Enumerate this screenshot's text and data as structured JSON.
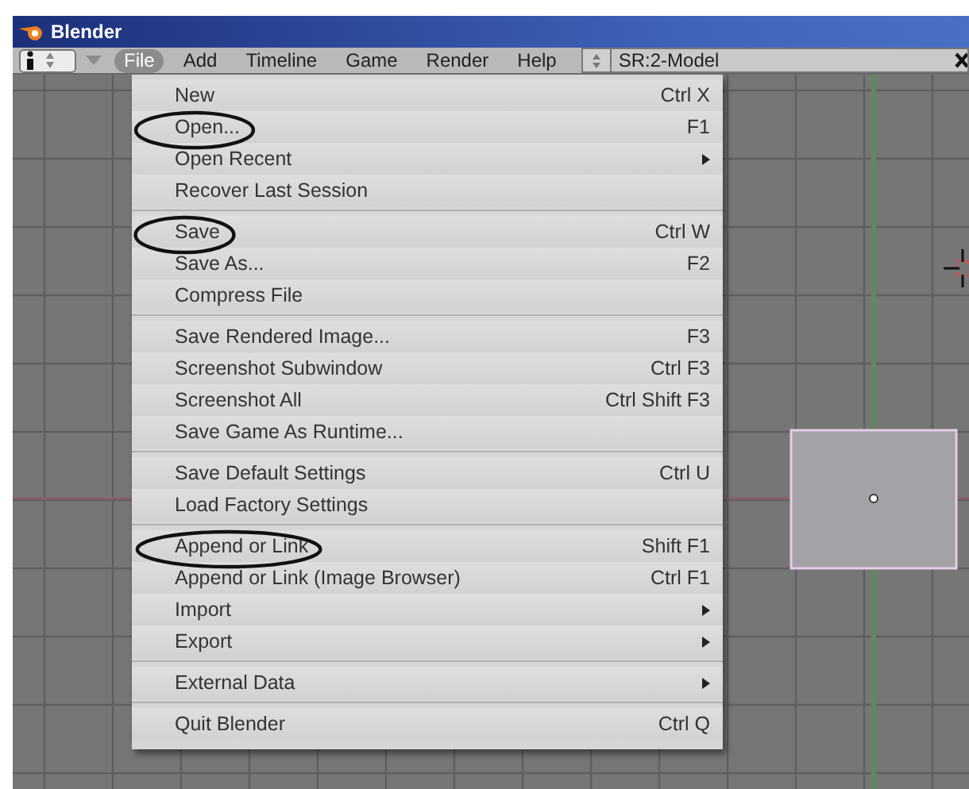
{
  "window": {
    "title": "Blender"
  },
  "header": {
    "menus": [
      {
        "label": "File",
        "selected": true
      },
      {
        "label": "Add",
        "selected": false
      },
      {
        "label": "Timeline",
        "selected": false
      },
      {
        "label": "Game",
        "selected": false
      },
      {
        "label": "Render",
        "selected": false
      },
      {
        "label": "Help",
        "selected": false
      }
    ],
    "scene_selector": {
      "value": "SR:2-Model"
    }
  },
  "file_menu": {
    "groups": [
      {
        "items": [
          {
            "label": "New",
            "shortcut": "Ctrl X",
            "submenu": false,
            "circled": false
          },
          {
            "label": "Open...",
            "shortcut": "F1",
            "submenu": false,
            "circled": true
          },
          {
            "label": "Open Recent",
            "submenu": true,
            "circled": false
          },
          {
            "label": "Recover Last Session",
            "submenu": false,
            "circled": false
          }
        ]
      },
      {
        "items": [
          {
            "label": "Save",
            "shortcut": "Ctrl W",
            "submenu": false,
            "circled": true
          },
          {
            "label": "Save As...",
            "shortcut": "F2",
            "submenu": false,
            "circled": false
          },
          {
            "label": "Compress File",
            "submenu": false,
            "circled": false
          }
        ]
      },
      {
        "items": [
          {
            "label": "Save Rendered Image...",
            "shortcut": "F3",
            "submenu": false,
            "circled": false
          },
          {
            "label": "Screenshot Subwindow",
            "shortcut": "Ctrl F3",
            "submenu": false,
            "circled": false
          },
          {
            "label": "Screenshot All",
            "shortcut": "Ctrl Shift F3",
            "submenu": false,
            "circled": false
          },
          {
            "label": "Save Game As Runtime...",
            "submenu": false,
            "circled": false
          }
        ]
      },
      {
        "items": [
          {
            "label": "Save Default Settings",
            "shortcut": "Ctrl U",
            "submenu": false,
            "circled": false
          },
          {
            "label": "Load Factory Settings",
            "submenu": false,
            "circled": false
          }
        ]
      },
      {
        "items": [
          {
            "label": "Append or Link",
            "shortcut": "Shift F1",
            "submenu": false,
            "circled": true
          },
          {
            "label": "Append or Link (Image Browser)",
            "shortcut": "Ctrl F1",
            "submenu": false,
            "circled": false
          },
          {
            "label": "Import",
            "submenu": true,
            "circled": false
          },
          {
            "label": "Export",
            "submenu": true,
            "circled": false
          }
        ]
      },
      {
        "items": [
          {
            "label": "External Data",
            "submenu": true,
            "circled": false
          }
        ]
      },
      {
        "items": [
          {
            "label": "Quit Blender",
            "shortcut": "Ctrl Q",
            "submenu": false,
            "circled": false
          }
        ]
      }
    ]
  }
}
